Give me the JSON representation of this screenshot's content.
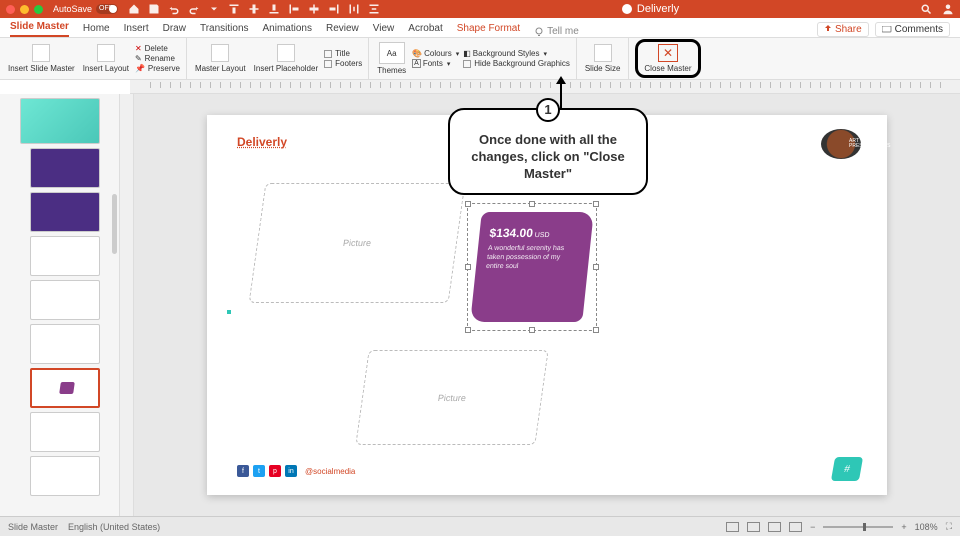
{
  "titlebar": {
    "autosave": "AutoSave",
    "autosave_state": "OFF",
    "doc_title": "Deliverly"
  },
  "tabs": {
    "slide_master": "Slide Master",
    "home": "Home",
    "insert": "Insert",
    "draw": "Draw",
    "transitions": "Transitions",
    "animations": "Animations",
    "review": "Review",
    "view": "View",
    "acrobat": "Acrobat",
    "shape_format": "Shape Format",
    "tell_me": "Tell me",
    "share": "Share",
    "comments": "Comments"
  },
  "ribbon": {
    "insert_slide_master": "Insert Slide Master",
    "insert_layout": "Insert Layout",
    "delete": "Delete",
    "rename": "Rename",
    "preserve": "Preserve",
    "master_layout": "Master Layout",
    "insert_placeholder": "Insert Placeholder",
    "title": "Title",
    "footers": "Footers",
    "themes": "Themes",
    "colours": "Colours",
    "fonts": "Fonts",
    "background_styles": "Background Styles",
    "hide_background": "Hide Background Graphics",
    "slide_size": "Slide Size",
    "close_master": "Close Master"
  },
  "callout": {
    "number": "1",
    "text": "Once done with all the changes, click on \"Close Master\""
  },
  "slide": {
    "brand": "Deliverly",
    "logo_text": "ART OF PRESENTATIONS",
    "placeholder1": "Picture",
    "placeholder2": "Picture",
    "price": "$134.00",
    "price_currency": "USD",
    "price_desc": "A wonderful serenity has taken possession of my entire soul",
    "social_handle": "@socialmedia",
    "page_badge": "#"
  },
  "status": {
    "mode": "Slide Master",
    "language": "English (United States)",
    "zoom": "108%"
  }
}
